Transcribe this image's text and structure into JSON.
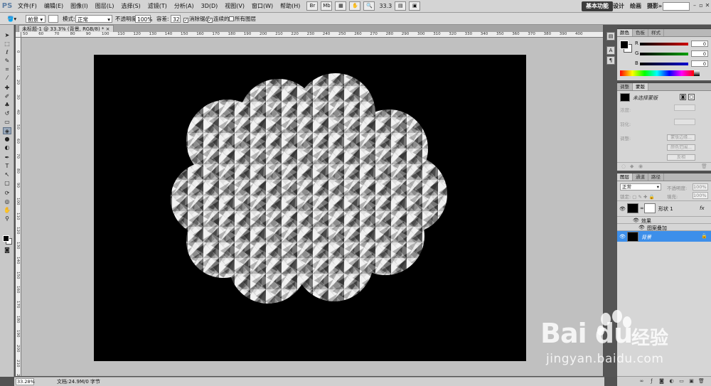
{
  "app": {
    "logo": "PS",
    "menus": [
      "文件(F)",
      "编辑(E)",
      "图像(I)",
      "图层(L)",
      "选择(S)",
      "滤镜(T)",
      "分析(A)",
      "3D(D)",
      "视图(V)",
      "窗口(W)",
      "帮助(H)"
    ],
    "zoom_display": "33.3",
    "workspaces": [
      "基本功能",
      "设计",
      "绘画",
      "摄影"
    ],
    "workspace_more": "»"
  },
  "options": {
    "source_label": "前景",
    "mode_label": "模式:",
    "mode_value": "正常",
    "opacity_label": "不透明度:",
    "opacity_value": "100%",
    "tolerance_label": "容差:",
    "tolerance_value": "32",
    "antialias_label": "消除锯齿",
    "contiguous_label": "连续的",
    "all_layers_label": "所有图层"
  },
  "document": {
    "tab_title": "未标题-1 @ 33.3% (背景, RGB/8) *"
  },
  "rulers": {
    "horizontal": [
      "50",
      "60",
      "70",
      "80",
      "90",
      "100",
      "110",
      "120",
      "130",
      "140",
      "150",
      "160",
      "170",
      "180",
      "190",
      "200",
      "210",
      "220",
      "230",
      "240",
      "250",
      "260",
      "270",
      "280",
      "290",
      "300",
      "310",
      "320",
      "330",
      "340",
      "350",
      "360",
      "370",
      "380",
      "390",
      "400"
    ],
    "vertical": [
      "0",
      "10",
      "20",
      "30",
      "40",
      "50",
      "60",
      "70",
      "80",
      "90",
      "100",
      "110",
      "120",
      "130",
      "140",
      "150",
      "160",
      "170",
      "180",
      "190",
      "200",
      "210",
      "220"
    ]
  },
  "status": {
    "zoom": "33.28%",
    "doc_info": "文档:24.9M/0 字节"
  },
  "color_panel": {
    "tabs": [
      "颜色",
      "色板",
      "样式"
    ],
    "channels": [
      {
        "label": "R",
        "value": "0",
        "gradient": "#d00000"
      },
      {
        "label": "G",
        "value": "0",
        "gradient": "#00a000"
      },
      {
        "label": "B",
        "value": "0",
        "gradient": "#0000d0"
      }
    ]
  },
  "adjust_panel": {
    "tabs": [
      "调整",
      "蒙版"
    ],
    "title": "未选择蒙版",
    "density_label": "浓度:",
    "feather_label": "羽化:",
    "refine_label": "调整:",
    "buttons": [
      "蒙版边缘...",
      "颜色范围...",
      "反相"
    ]
  },
  "layers_panel": {
    "tabs": [
      "图层",
      "通道",
      "路径"
    ],
    "blend_mode": "正常",
    "opacity_label": "不透明度:",
    "opacity_value": "100%",
    "lock_label": "锁定:",
    "fill_label": "填充:",
    "fill_value": "100%",
    "layers": [
      {
        "name": "形状 1",
        "fx": "fx"
      },
      {
        "name": "效果"
      },
      {
        "name": "图案叠加"
      },
      {
        "name": "背景"
      }
    ]
  },
  "watermark": {
    "brand": "Bai du",
    "brand_suffix": "经验",
    "url": "jingyan.baidu.com"
  }
}
